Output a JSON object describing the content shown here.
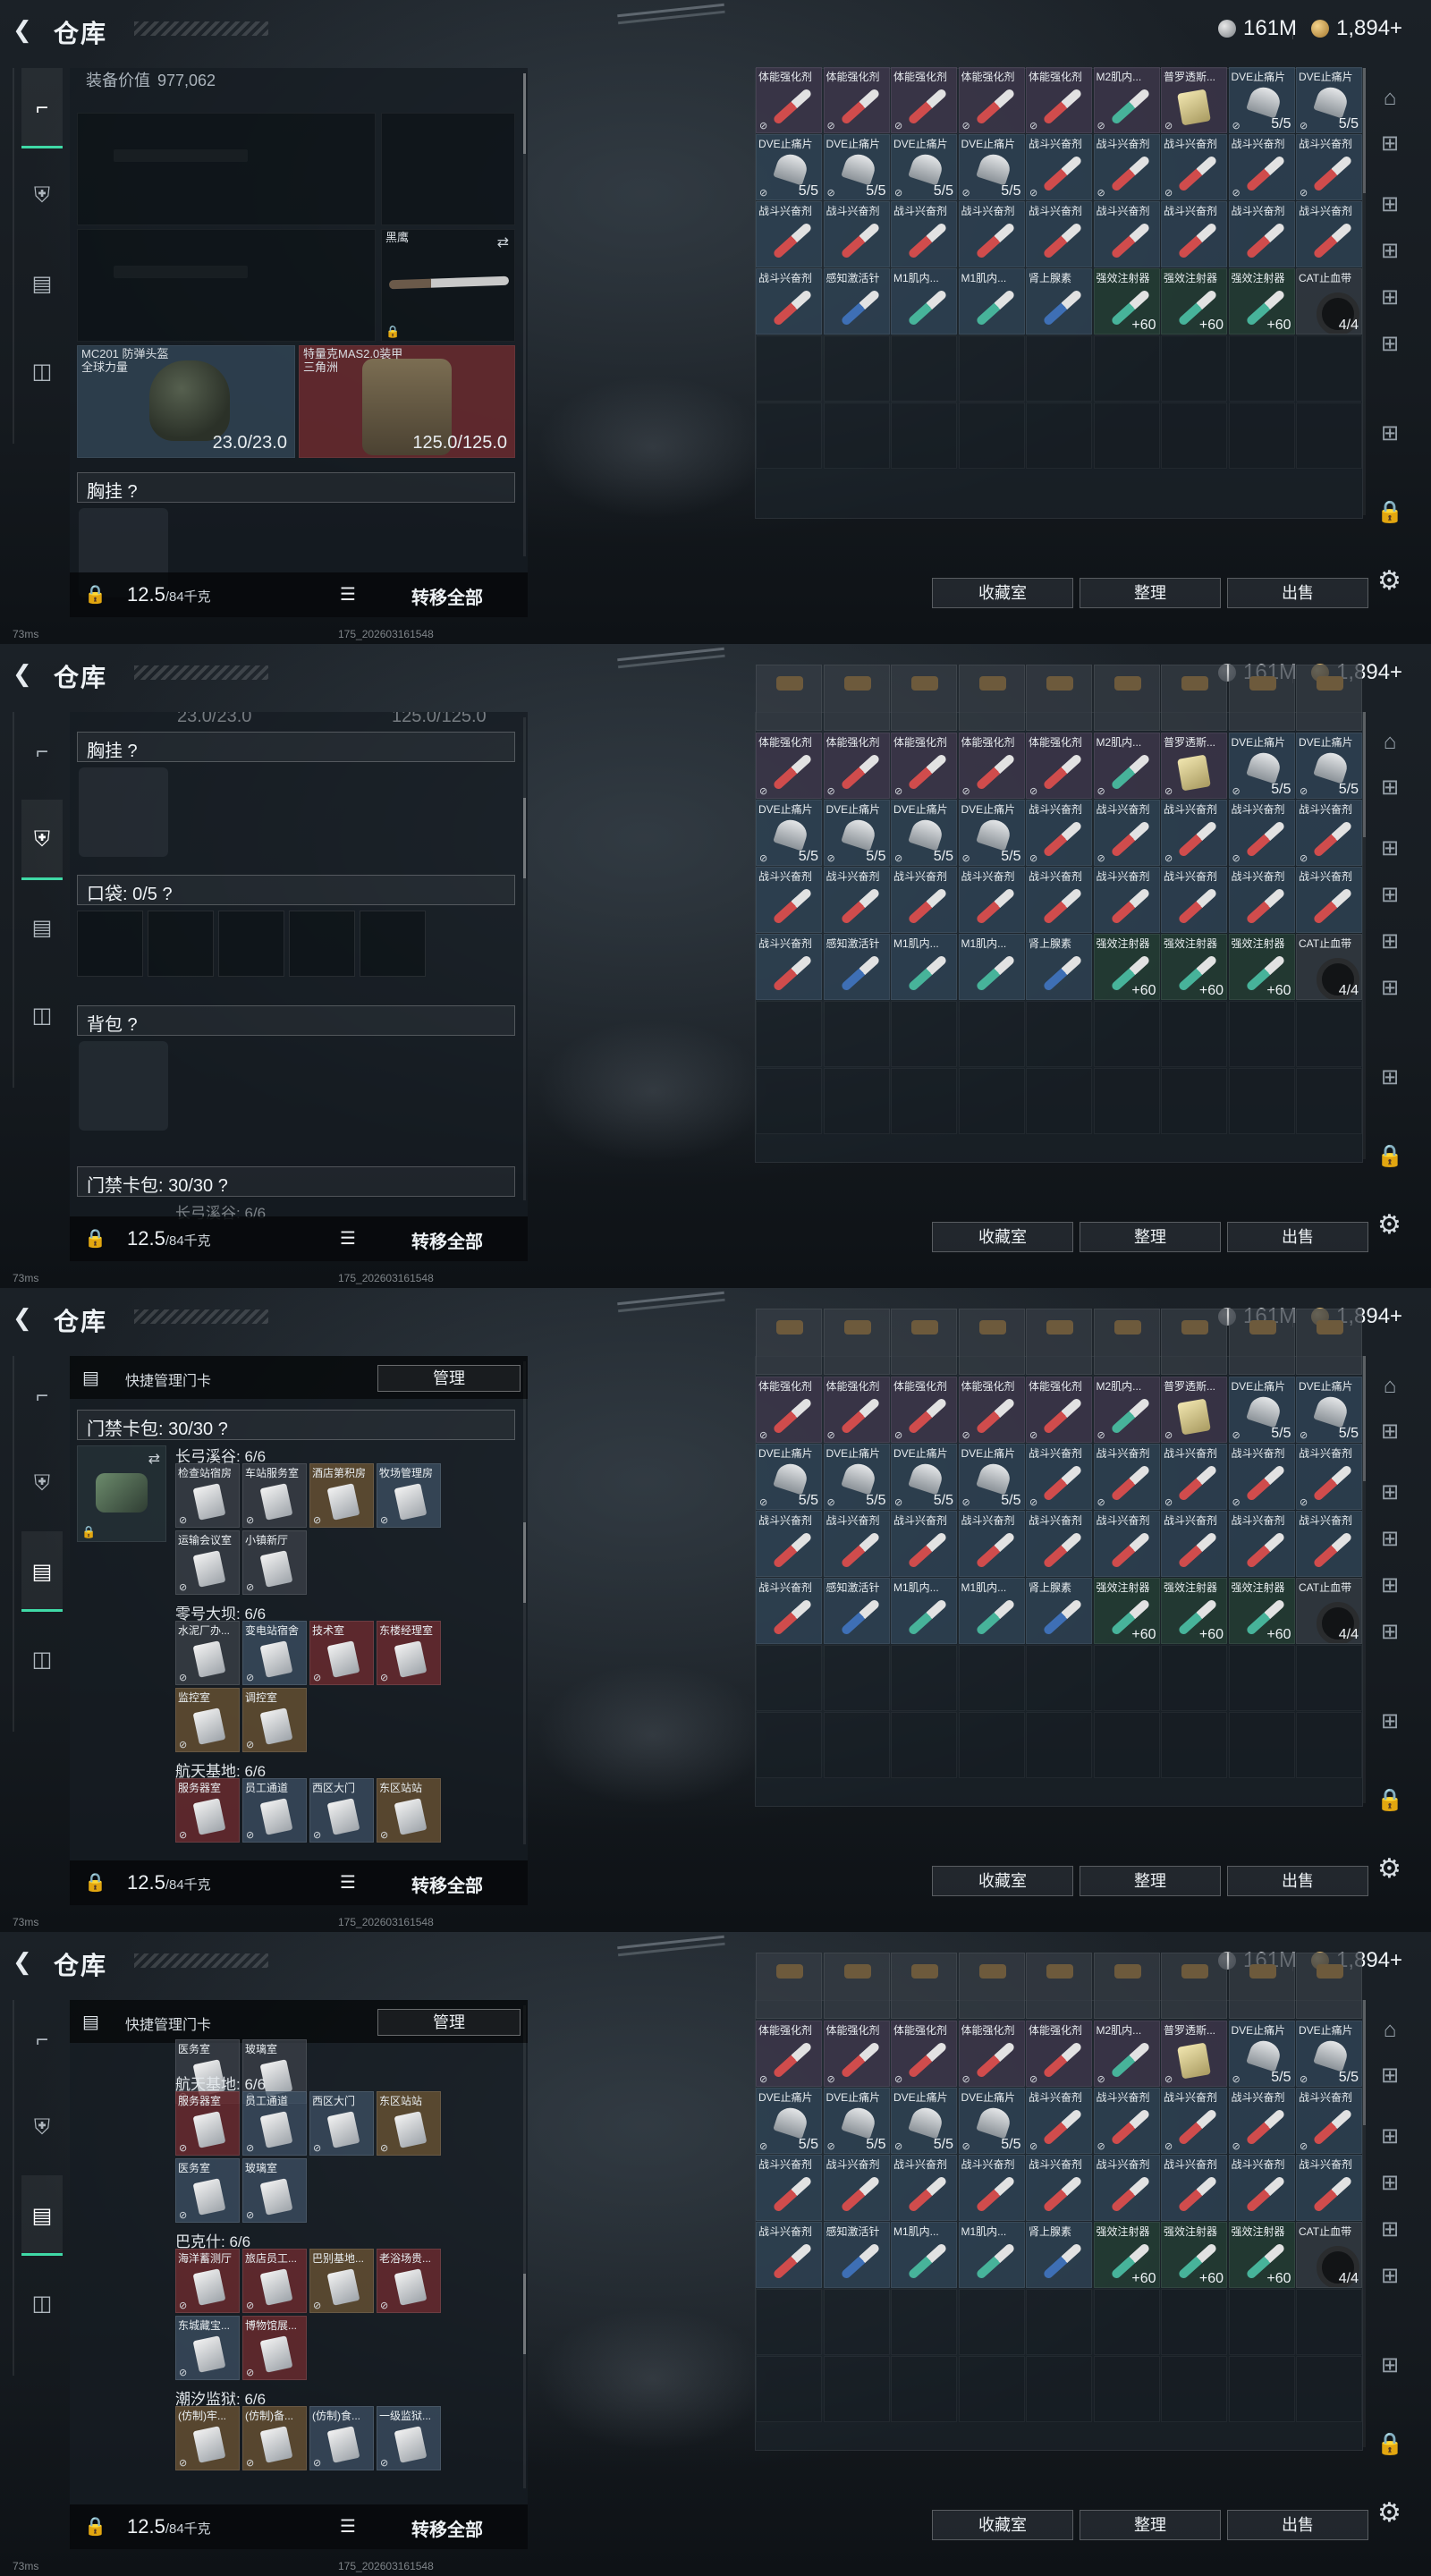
{
  "header": {
    "title": "仓库",
    "silver_amount": "161M",
    "gold_amount": "1,894+"
  },
  "equip": {
    "value_label": "装备价值",
    "value": "977,062",
    "knife_name": "黑鹰",
    "helmet_name": "MC201 防弹头盔",
    "helmet_sub": "全球力量",
    "helmet_durability": "23.0/23.0",
    "armor_name": "特量克MAS2.0装甲",
    "armor_sub": "三角洲",
    "armor_durability": "125.0/125.0",
    "chest_rig_label": "胸挂 ?",
    "pocket_label": "口袋: 0/5 ?",
    "backpack_label": "背包 ?",
    "keybag_label": "门禁卡包: 30/30 ?",
    "keybag_peek": "长弓溪谷: 6/6"
  },
  "keys": {
    "header_text": "快捷管理门卡",
    "manage_label": "管理",
    "groups_frame3": [
      {
        "title": "长弓溪谷: 6/6",
        "cards": [
          {
            "name": "检查站宿房",
            "color": "gray"
          },
          {
            "name": "车站服务室",
            "color": "gray"
          },
          {
            "name": "酒店第积房",
            "color": "gold"
          },
          {
            "name": "牧场管理房",
            "color": "blue"
          },
          {
            "name": "运输会议室",
            "color": "gray"
          },
          {
            "name": "小镇新厅",
            "color": "gray"
          }
        ]
      },
      {
        "title": "零号大坝: 6/6",
        "cards": [
          {
            "name": "水泥厂办...",
            "color": "gray"
          },
          {
            "name": "变电站宿舍",
            "color": "blue"
          },
          {
            "name": "技术室",
            "color": "red"
          },
          {
            "name": "东楼经理室",
            "color": "red"
          },
          {
            "name": "监控室",
            "color": "gold"
          },
          {
            "name": "调控室",
            "color": "gold"
          }
        ]
      },
      {
        "title": "航天基地: 6/6",
        "cards": [
          {
            "name": "服务器室",
            "color": "red"
          },
          {
            "name": "员工通道",
            "color": "blue"
          },
          {
            "name": "西区大门",
            "color": "blue"
          },
          {
            "name": "东区站站",
            "color": "gold"
          }
        ]
      }
    ],
    "groups_frame4": [
      {
        "title": "航天基地: 6/6",
        "cards": [
          {
            "name": "服务器室",
            "color": "red"
          },
          {
            "name": "员工通道",
            "color": "blue"
          },
          {
            "name": "西区大门",
            "color": "blue"
          },
          {
            "name": "东区站站",
            "color": "gold"
          },
          {
            "name": "医务室",
            "color": "blue"
          },
          {
            "name": "玻璃室",
            "color": "blue"
          }
        ]
      },
      {
        "title": "巴克什: 6/6",
        "cards": [
          {
            "name": "海洋蓄测厅",
            "color": "red"
          },
          {
            "name": "旅店员工...",
            "color": "red"
          },
          {
            "name": "巴别基地...",
            "color": "gold"
          },
          {
            "name": "老浴场贵...",
            "color": "red"
          },
          {
            "name": "东城藏宝...",
            "color": "blue"
          },
          {
            "name": "博物馆展...",
            "color": "red"
          }
        ]
      },
      {
        "title": "潮汐监狱: 6/6",
        "cards": [
          {
            "name": "(仿制)牢...",
            "color": "gold"
          },
          {
            "name": "(仿制)备...",
            "color": "gold"
          },
          {
            "name": "(仿制)食...",
            "color": "blue"
          },
          {
            "name": "一级监狱...",
            "color": "blue"
          }
        ]
      }
    ]
  },
  "footer": {
    "weight_main": "12.5",
    "weight_unit": "/84千克",
    "transfer_label": "转移全部"
  },
  "inventory": {
    "rows": [
      [
        {
          "name": "体能强化剂",
          "type": "syringe",
          "bg": "purple"
        },
        {
          "name": "体能强化剂",
          "type": "syringe",
          "bg": "purple"
        },
        {
          "name": "体能强化剂",
          "type": "syringe",
          "bg": "purple"
        },
        {
          "name": "体能强化剂",
          "type": "syringe",
          "bg": "purple"
        },
        {
          "name": "体能强化剂",
          "type": "syringe",
          "bg": "purple"
        },
        {
          "name": "M2肌内...",
          "type": "syringe-g",
          "bg": "purple"
        },
        {
          "name": "普罗透斯...",
          "type": "pack",
          "bg": "purple"
        },
        {
          "name": "DVE止痛片",
          "type": "pills",
          "bg": "blue",
          "count": "5/5"
        },
        {
          "name": "DVE止痛片",
          "type": "pills",
          "bg": "blue",
          "count": "5/5"
        }
      ],
      [
        {
          "name": "DVE止痛片",
          "type": "pills",
          "bg": "blue",
          "count": "5/5"
        },
        {
          "name": "DVE止痛片",
          "type": "pills",
          "bg": "blue",
          "count": "5/5"
        },
        {
          "name": "DVE止痛片",
          "type": "pills",
          "bg": "blue",
          "count": "5/5"
        },
        {
          "name": "DVE止痛片",
          "type": "pills",
          "bg": "blue",
          "count": "5/5"
        },
        {
          "name": "战斗兴奋剂",
          "type": "syringe",
          "bg": "blue"
        },
        {
          "name": "战斗兴奋剂",
          "type": "syringe",
          "bg": "blue"
        },
        {
          "name": "战斗兴奋剂",
          "type": "syringe",
          "bg": "blue"
        },
        {
          "name": "战斗兴奋剂",
          "type": "syringe",
          "bg": "blue"
        },
        {
          "name": "战斗兴奋剂",
          "type": "syringe",
          "bg": "blue"
        }
      ],
      [
        {
          "name": "战斗兴奋剂",
          "type": "syringe",
          "bg": "blue"
        },
        {
          "name": "战斗兴奋剂",
          "type": "syringe",
          "bg": "blue"
        },
        {
          "name": "战斗兴奋剂",
          "type": "syringe",
          "bg": "blue"
        },
        {
          "name": "战斗兴奋剂",
          "type": "syringe",
          "bg": "blue"
        },
        {
          "name": "战斗兴奋剂",
          "type": "syringe",
          "bg": "blue"
        },
        {
          "name": "战斗兴奋剂",
          "type": "syringe",
          "bg": "blue"
        },
        {
          "name": "战斗兴奋剂",
          "type": "syringe",
          "bg": "blue"
        },
        {
          "name": "战斗兴奋剂",
          "type": "syringe",
          "bg": "blue"
        },
        {
          "name": "战斗兴奋剂",
          "type": "syringe",
          "bg": "blue"
        }
      ],
      [
        {
          "name": "战斗兴奋剂",
          "type": "syringe",
          "bg": "blue"
        },
        {
          "name": "感知激活针",
          "type": "syringe-b",
          "bg": "blue"
        },
        {
          "name": "M1肌内...",
          "type": "syringe-g",
          "bg": "blue"
        },
        {
          "name": "M1肌内...",
          "type": "syringe-g",
          "bg": "blue"
        },
        {
          "name": "肾上腺素",
          "type": "syringe-b",
          "bg": "blue"
        },
        {
          "name": "强效注射器",
          "type": "syringe-g",
          "bg": "green",
          "count": "+60"
        },
        {
          "name": "强效注射器",
          "type": "syringe-g",
          "bg": "green",
          "count": "+60"
        },
        {
          "name": "强效注射器",
          "type": "syringe-g",
          "bg": "green",
          "count": "+60"
        },
        {
          "name": "CAT止血带",
          "type": "tourniquet",
          "bg": "gray",
          "count": "4/4"
        }
      ]
    ],
    "buttons": [
      "收藏室",
      "整理",
      "出售"
    ]
  },
  "status": {
    "ping": "73ms",
    "build": "175_202603161548"
  },
  "icons": {
    "back": "chevron-left-icon",
    "tab_weapon": "pistol-icon",
    "tab_armor": "armor-vest-icon",
    "tab_keycards": "clipboard-icon",
    "tab_bag": "briefcase-icon",
    "settings": "gear-icon"
  },
  "colors": {
    "active_tab": "#3fd9a6",
    "card_red": "#702c30",
    "card_gold": "#6e5634",
    "card_blue": "#3e5064"
  }
}
